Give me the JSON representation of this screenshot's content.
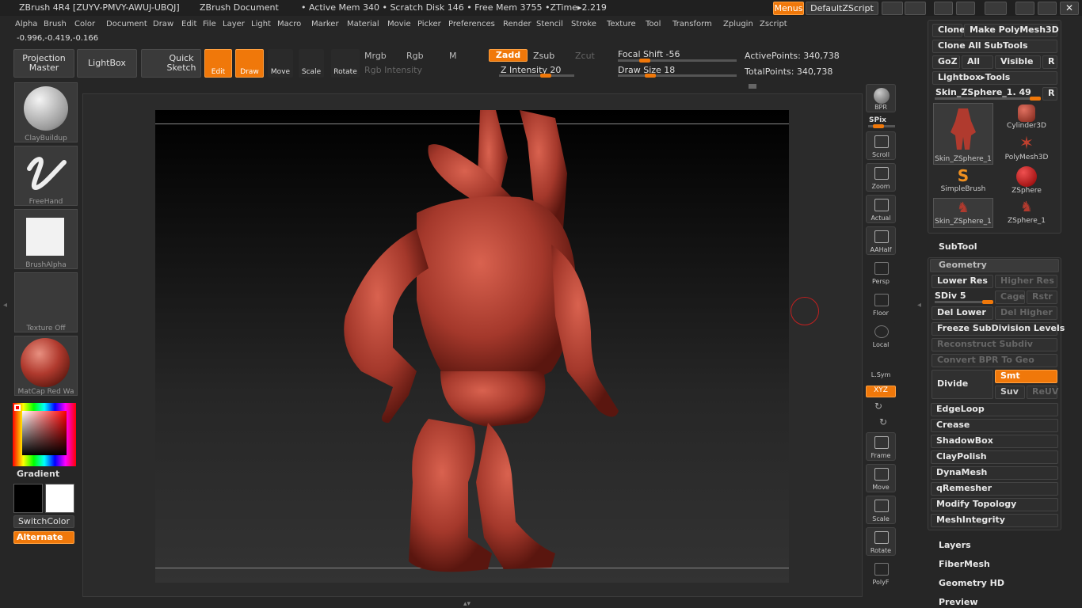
{
  "titlebar": {
    "app_title": "ZBrush 4R4 [ZUYV-PMVY-AWUJ-UBQJ]",
    "document": "ZBrush Document",
    "stats": "• Active Mem 340 • Scratch Disk 146 • Free Mem 3755 •ZTime▸2.219",
    "menus_label": "Menus",
    "default_zscript": "DefaultZScript"
  },
  "menubar": [
    "Alpha",
    "Brush",
    "Color",
    "Document",
    "Draw",
    "Edit",
    "File",
    "Layer",
    "Light",
    "Macro",
    "Marker",
    "Material",
    "Movie",
    "Picker",
    "Preferences",
    "Render",
    "Stencil",
    "Stroke",
    "Texture",
    "Tool",
    "Transform",
    "Zplugin",
    "Zscript"
  ],
  "coords": "-0.996,-0.419,-0.166",
  "toolbar": {
    "projection_master": "Projection Master",
    "lightbox": "LightBox",
    "quick_sketch": "Quick Sketch",
    "edit": "Edit",
    "draw": "Draw",
    "move": "Move",
    "scale": "Scale",
    "rotate": "Rotate",
    "mrgb": "Mrgb",
    "rgb": "Rgb",
    "m": "M",
    "rgb_intensity": "Rgb Intensity",
    "zadd": "Zadd",
    "zsub": "Zsub",
    "zcut": "Zcut",
    "z_intensity": "Z Intensity 20",
    "focal_shift": "Focal Shift -56",
    "draw_size": "Draw Size 18",
    "active_points": "ActivePoints: 340,738",
    "total_points": "TotalPoints: 340,738"
  },
  "left_shelf": {
    "brush": "ClayBuildup",
    "stroke": "FreeHand",
    "alpha": "BrushAlpha",
    "texture": "Texture Off",
    "material": "MatCap Red Wa",
    "gradient": "Gradient",
    "switch_color": "SwitchColor",
    "alternate": "Alternate"
  },
  "right_tools": {
    "bpr": "BPR",
    "spix": "SPix",
    "scroll": "Scroll",
    "zoom": "Zoom",
    "actual": "Actual",
    "aahalf": "AAHalf",
    "persp": "Persp",
    "floor": "Floor",
    "local": "Local",
    "lsym": "L.Sym",
    "xyz": "XYZ",
    "frame": "Frame",
    "move": "Move",
    "scale": "Scale",
    "rotate": "Rotate",
    "polyf": "PolyF"
  },
  "tool_panel": {
    "clone": "Clone",
    "make_polymesh": "Make PolyMesh3D",
    "clone_all": "Clone All SubTools",
    "goz": "GoZ",
    "all": "All",
    "visible": "Visible",
    "r": "R",
    "lightbox_tools": "Lightbox▸Tools",
    "current_tool": "Skin_ZSphere_1. 49",
    "thumbs": [
      "Skin_ZSphere_1",
      "Cylinder3D",
      "PolyMesh3D",
      "SimpleBrush",
      "ZSphere",
      "Skin_ZSphere_1",
      "ZSphere_1"
    ],
    "subtool": "SubTool",
    "geometry": "Geometry",
    "lower_res": "Lower Res",
    "higher_res": "Higher Res",
    "sdiv": "SDiv 5",
    "cage": "Cage",
    "rstr": "Rstr",
    "del_lower": "Del Lower",
    "del_higher": "Del Higher",
    "freeze": "Freeze SubDivision Levels",
    "reconstruct": "Reconstruct Subdiv",
    "convert_bpr": "Convert BPR To Geo",
    "divide": "Divide",
    "smt": "Smt",
    "suv": "Suv",
    "reuv": "ReUV",
    "items": [
      "EdgeLoop",
      "Crease",
      "ShadowBox",
      "ClayPolish",
      "DynaMesh",
      "qRemesher",
      "Modify Topology",
      "MeshIntegrity"
    ],
    "sections": [
      "Layers",
      "FiberMesh",
      "Geometry HD",
      "Preview"
    ]
  },
  "colors": {
    "accent": "#f0780a",
    "model": "#b03a2e"
  }
}
